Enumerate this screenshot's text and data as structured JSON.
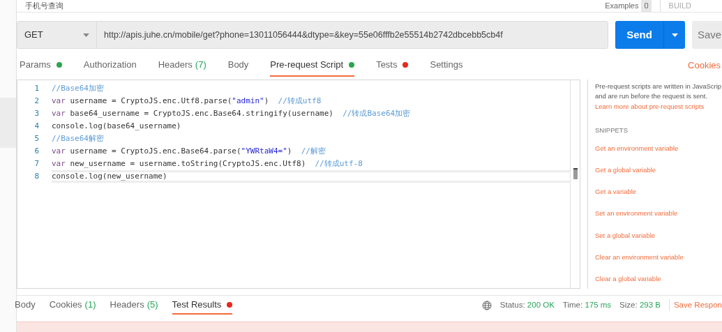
{
  "request_title": "手机号查询",
  "examples": {
    "label": "Examples",
    "count": "0"
  },
  "mode_label": "BUILD",
  "request": {
    "method": "GET",
    "url": "http://apis.juhe.cn/mobile/get?phone=13011056444&dtype=&key=55e06fffb2e55514b2742dbcebb5cb4f",
    "send": "Send",
    "save": "Save"
  },
  "tabs": [
    {
      "label": "Params",
      "color": "#2ea44f",
      "selected": false
    },
    {
      "label": "Authorization",
      "selected": false
    },
    {
      "label": "Headers",
      "count": "(7)",
      "selected": false
    },
    {
      "label": "Body",
      "selected": false
    },
    {
      "label": "Pre-request Script",
      "color": "#2ea44f",
      "selected": true
    },
    {
      "label": "Tests",
      "color": "#e8261c",
      "selected": false
    },
    {
      "label": "Settings",
      "selected": false
    }
  ],
  "cookies_link": "Cookies",
  "code_lines": [
    {
      "number": "1",
      "active": false,
      "tokens": [
        {
          "kind": "comment",
          "text": "//Base64加密"
        }
      ]
    },
    {
      "number": "2",
      "active": false,
      "tokens": [
        {
          "kind": "keyword",
          "text": "var"
        },
        {
          "kind": "plain",
          "text": " username = CryptoJS.enc.Utf8.parse("
        },
        {
          "kind": "string",
          "text": "\"admin\""
        },
        {
          "kind": "plain",
          "text": ")  "
        },
        {
          "kind": "comment",
          "text": "//转成utf8"
        }
      ]
    },
    {
      "number": "3",
      "active": false,
      "tokens": [
        {
          "kind": "keyword",
          "text": "var"
        },
        {
          "kind": "plain",
          "text": " base64_username = CryptoJS.enc.Base64.stringify(username)  "
        },
        {
          "kind": "comment",
          "text": "//转成Base64加密"
        }
      ]
    },
    {
      "number": "4",
      "active": false,
      "tokens": [
        {
          "kind": "plain",
          "text": "console.log(base64_username)"
        }
      ]
    },
    {
      "number": "5",
      "active": false,
      "tokens": [
        {
          "kind": "comment",
          "text": "//Base64解密"
        }
      ]
    },
    {
      "number": "6",
      "active": false,
      "tokens": [
        {
          "kind": "keyword",
          "text": "var"
        },
        {
          "kind": "plain",
          "text": " username = CryptoJS.enc.Base64.parse("
        },
        {
          "kind": "string",
          "text": "\"YWRtaW4=\""
        },
        {
          "kind": "plain",
          "text": ")  "
        },
        {
          "kind": "comment",
          "text": "//解密"
        }
      ]
    },
    {
      "number": "7",
      "active": false,
      "tokens": [
        {
          "kind": "keyword",
          "text": "var"
        },
        {
          "kind": "plain",
          "text": " new_username = username.toString(CryptoJS.enc.Utf8)  "
        },
        {
          "kind": "comment",
          "text": "//转成utf-8"
        }
      ]
    },
    {
      "number": "8",
      "active": true,
      "tokens": [
        {
          "kind": "plain",
          "text": "console.log(new_username)"
        }
      ]
    }
  ],
  "side_panel": {
    "description": [
      "Pre-request scripts are written in JavaScrip",
      "and are run before the request is sent."
    ],
    "learn_link": "Learn more about pre-request scripts",
    "snippets_heading": "SNIPPETS",
    "snippets": [
      "Get an environment variable",
      "Get a global variable",
      "Get a variable",
      "Set an environment variable",
      "Set a global variable",
      "Clear an environment variable",
      "Clear a global variable"
    ]
  },
  "response_tabs": [
    {
      "label": "Body",
      "selected": false
    },
    {
      "label": "Cookies",
      "count": "(1)",
      "selected": false
    },
    {
      "label": "Headers",
      "count": "(5)",
      "selected": false
    },
    {
      "label": "Test Results",
      "color": "#e8261c",
      "selected": true
    }
  ],
  "response_meta": [
    {
      "label": "Status:",
      "value": "200 OK"
    },
    {
      "label": "Time:",
      "value": "175 ms"
    },
    {
      "label": "Size:",
      "value": "293 B"
    }
  ],
  "save_response": "Save Respon"
}
